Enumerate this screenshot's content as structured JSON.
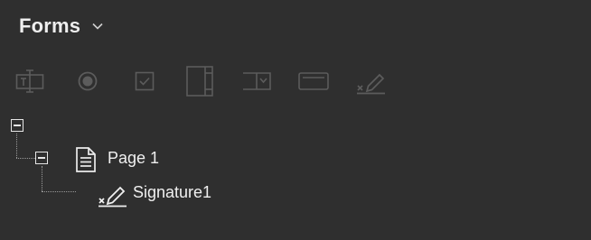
{
  "panel": {
    "title": "Forms",
    "colors": {
      "background": "#2f2f2f",
      "text": "#eeeeee",
      "icon_disabled": "#5c5c5c"
    }
  },
  "toolbar": {
    "tools": [
      {
        "name": "text-field-tool",
        "icon": "text-field-icon",
        "state": "disabled"
      },
      {
        "name": "radio-button-tool",
        "icon": "radio-button-icon",
        "state": "disabled"
      },
      {
        "name": "checkbox-tool",
        "icon": "checkbox-icon",
        "state": "disabled"
      },
      {
        "name": "list-box-tool",
        "icon": "list-box-icon",
        "state": "disabled"
      },
      {
        "name": "combo-box-tool",
        "icon": "combo-box-icon",
        "state": "disabled"
      },
      {
        "name": "button-tool",
        "icon": "button-icon",
        "state": "disabled"
      },
      {
        "name": "signature-tool",
        "icon": "signature-icon",
        "state": "disabled"
      }
    ]
  },
  "tree": {
    "root": {
      "expanded": true
    },
    "page": {
      "label": "Page 1",
      "icon": "page-icon",
      "expanded": true
    },
    "field": {
      "label": "Signature1",
      "icon": "signature-icon"
    }
  }
}
